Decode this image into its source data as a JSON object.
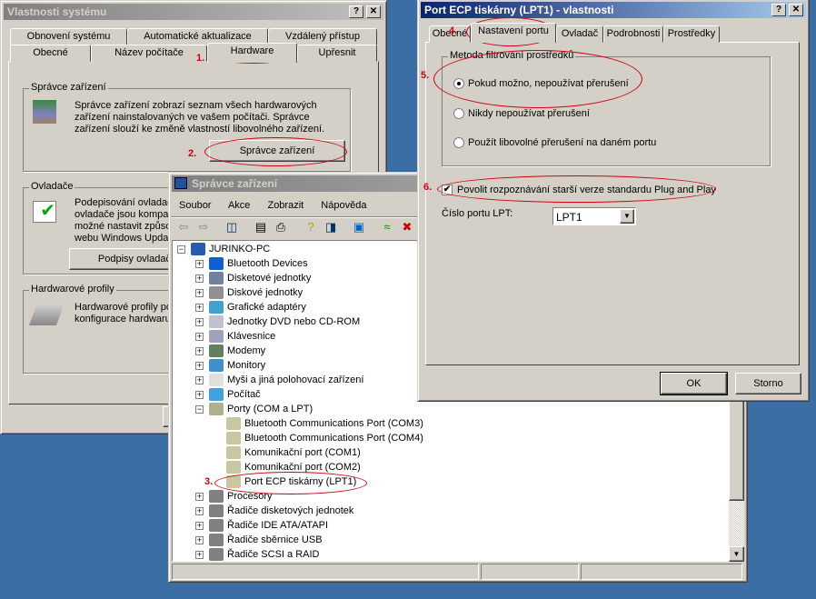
{
  "colors": {
    "desktop": "#3a6ea5",
    "annotation": "#d00010",
    "active_title": "#0a246a"
  },
  "system_props": {
    "title": "Vlastnosti systému",
    "tabs_row1": [
      "Obnovení systému",
      "Automatické aktualizace",
      "Vzdálený přístup"
    ],
    "tabs_row2": [
      "Obecné",
      "Název počítače",
      "Hardware",
      "Upřesnit"
    ],
    "device_manager_group": {
      "label": "Správce zařízení",
      "text": [
        "Správce zařízení zobrazí seznam všech hardwarových",
        "zařízení nainstalovaných ve vašem počítači. Správce",
        "zařízení slouží ke změně vlastností libovolného zařízení."
      ],
      "button": "Správce zařízení"
    },
    "drivers_group": {
      "label": "Ovladače",
      "text": [
        "Podepisování ovladač",
        "ovladače jsou kompat",
        "možné nastavit způso",
        "webu Windows Upda"
      ],
      "button": "Podpisy ovladačů"
    },
    "profiles_group": {
      "label": "Hardwarové profily",
      "text": [
        "Hardwarové profily po",
        "konfigurace hardwaru"
      ]
    }
  },
  "device_manager": {
    "title": "Správce zařízení",
    "menu": [
      "Soubor",
      "Akce",
      "Zobrazit",
      "Nápověda"
    ],
    "toolbar_icons": [
      "back-icon",
      "forward-icon",
      "console-tree-icon",
      "properties-icon",
      "print-icon",
      "help-icon",
      "details-icon",
      "scan-hardware-icon",
      "disable-icon",
      "uninstall-icon"
    ],
    "root": "JURINKO-PC",
    "categories": [
      "Bluetooth Devices",
      "Disketové jednotky",
      "Diskové jednotky",
      "Grafické adaptéry",
      "Jednotky DVD nebo CD-ROM",
      "Klávesnice",
      "Modemy",
      "Monitory",
      "Myši a jiná polohovací zařízení",
      "Počítač",
      "Porty (COM a LPT)"
    ],
    "ports": [
      "Bluetooth Communications Port (COM3)",
      "Bluetooth Communications Port (COM4)",
      "Komunikační port (COM1)",
      "Komunikační port (COM2)",
      "Port ECP tiskárny (LPT1)"
    ],
    "categories_after": [
      "Procesory",
      "Řadiče disketových jednotek",
      "Řadiče IDE ATA/ATAPI",
      "Řadiče sběrnice USB",
      "Řadiče SCSI a RAID"
    ]
  },
  "port_props": {
    "title": "Port ECP tiskárny (LPT1)  - vlastnosti",
    "tabs": [
      "Obecné",
      "Nastavení portu",
      "Ovladač",
      "Podrobnosti",
      "Prostředky"
    ],
    "group_label": "Metoda filtrování prostředků",
    "radios": [
      {
        "label": "Pokud možno, nepoužívat přerušení",
        "checked": true
      },
      {
        "label": "Nikdy nepoužívat přerušení",
        "checked": false
      },
      {
        "label": "Použít libovolné přerušení na daném portu",
        "checked": false
      }
    ],
    "checkbox": {
      "label": "Povolit rozpoznávání starší verze standardu Plug and Play",
      "checked": true
    },
    "lpt_label": "Číslo portu LPT:",
    "lpt_value": "LPT1",
    "ok": "OK",
    "cancel": "Storno"
  },
  "annotations": [
    "1.",
    "2.",
    "3.",
    "4.",
    "5.",
    "6."
  ],
  "title_buttons": {
    "help": "?",
    "close": "✕"
  }
}
